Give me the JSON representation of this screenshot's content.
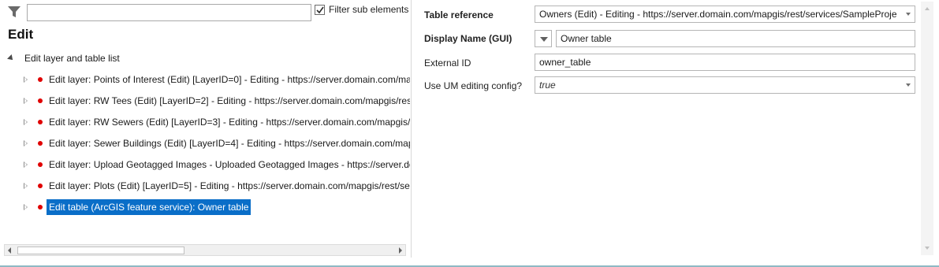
{
  "filter": {
    "value": "",
    "checkbox_checked": true,
    "checkbox_label": "Filter sub elements"
  },
  "panel_title": "Edit",
  "tree": {
    "root_label": "Edit layer and table list",
    "children": [
      {
        "label": "Edit layer: Points of Interest (Edit) [LayerID=0] - Editing - https://server.domain.com/mapg",
        "selected": false
      },
      {
        "label": "Edit layer: RW Tees (Edit) [LayerID=2] - Editing - https://server.domain.com/mapgis/rest/se",
        "selected": false
      },
      {
        "label": "Edit layer: RW Sewers (Edit) [LayerID=3] - Editing - https://server.domain.com/mapgis/rest",
        "selected": false
      },
      {
        "label": "Edit layer: Sewer Buildings (Edit) [LayerID=4] - Editing - https://server.domain.com/mapgis",
        "selected": false
      },
      {
        "label": "Edit layer: Upload Geotagged Images - Uploaded Geotagged Images - https://server.dom",
        "selected": false
      },
      {
        "label": "Edit layer: Plots (Edit) [LayerID=5] - Editing - https://server.domain.com/mapgis/rest/servic",
        "selected": false
      },
      {
        "label": "Edit table (ArcGIS feature service): Owner table",
        "selected": true
      }
    ]
  },
  "properties": {
    "table_reference": {
      "label": "Table reference",
      "value": "Owners (Edit) - Editing - https://server.domain.com/mapgis/rest/services/SampleProje"
    },
    "display_name": {
      "label": "Display Name (GUI)",
      "value": "Owner table"
    },
    "external_id": {
      "label": "External ID",
      "value": "owner_table"
    },
    "use_um_editing": {
      "label": "Use UM editing config?",
      "value": "true"
    }
  },
  "colors": {
    "selection": "#0a6ec8",
    "status_dot": "#e00000",
    "bottom_border": "#8fb9c4"
  }
}
